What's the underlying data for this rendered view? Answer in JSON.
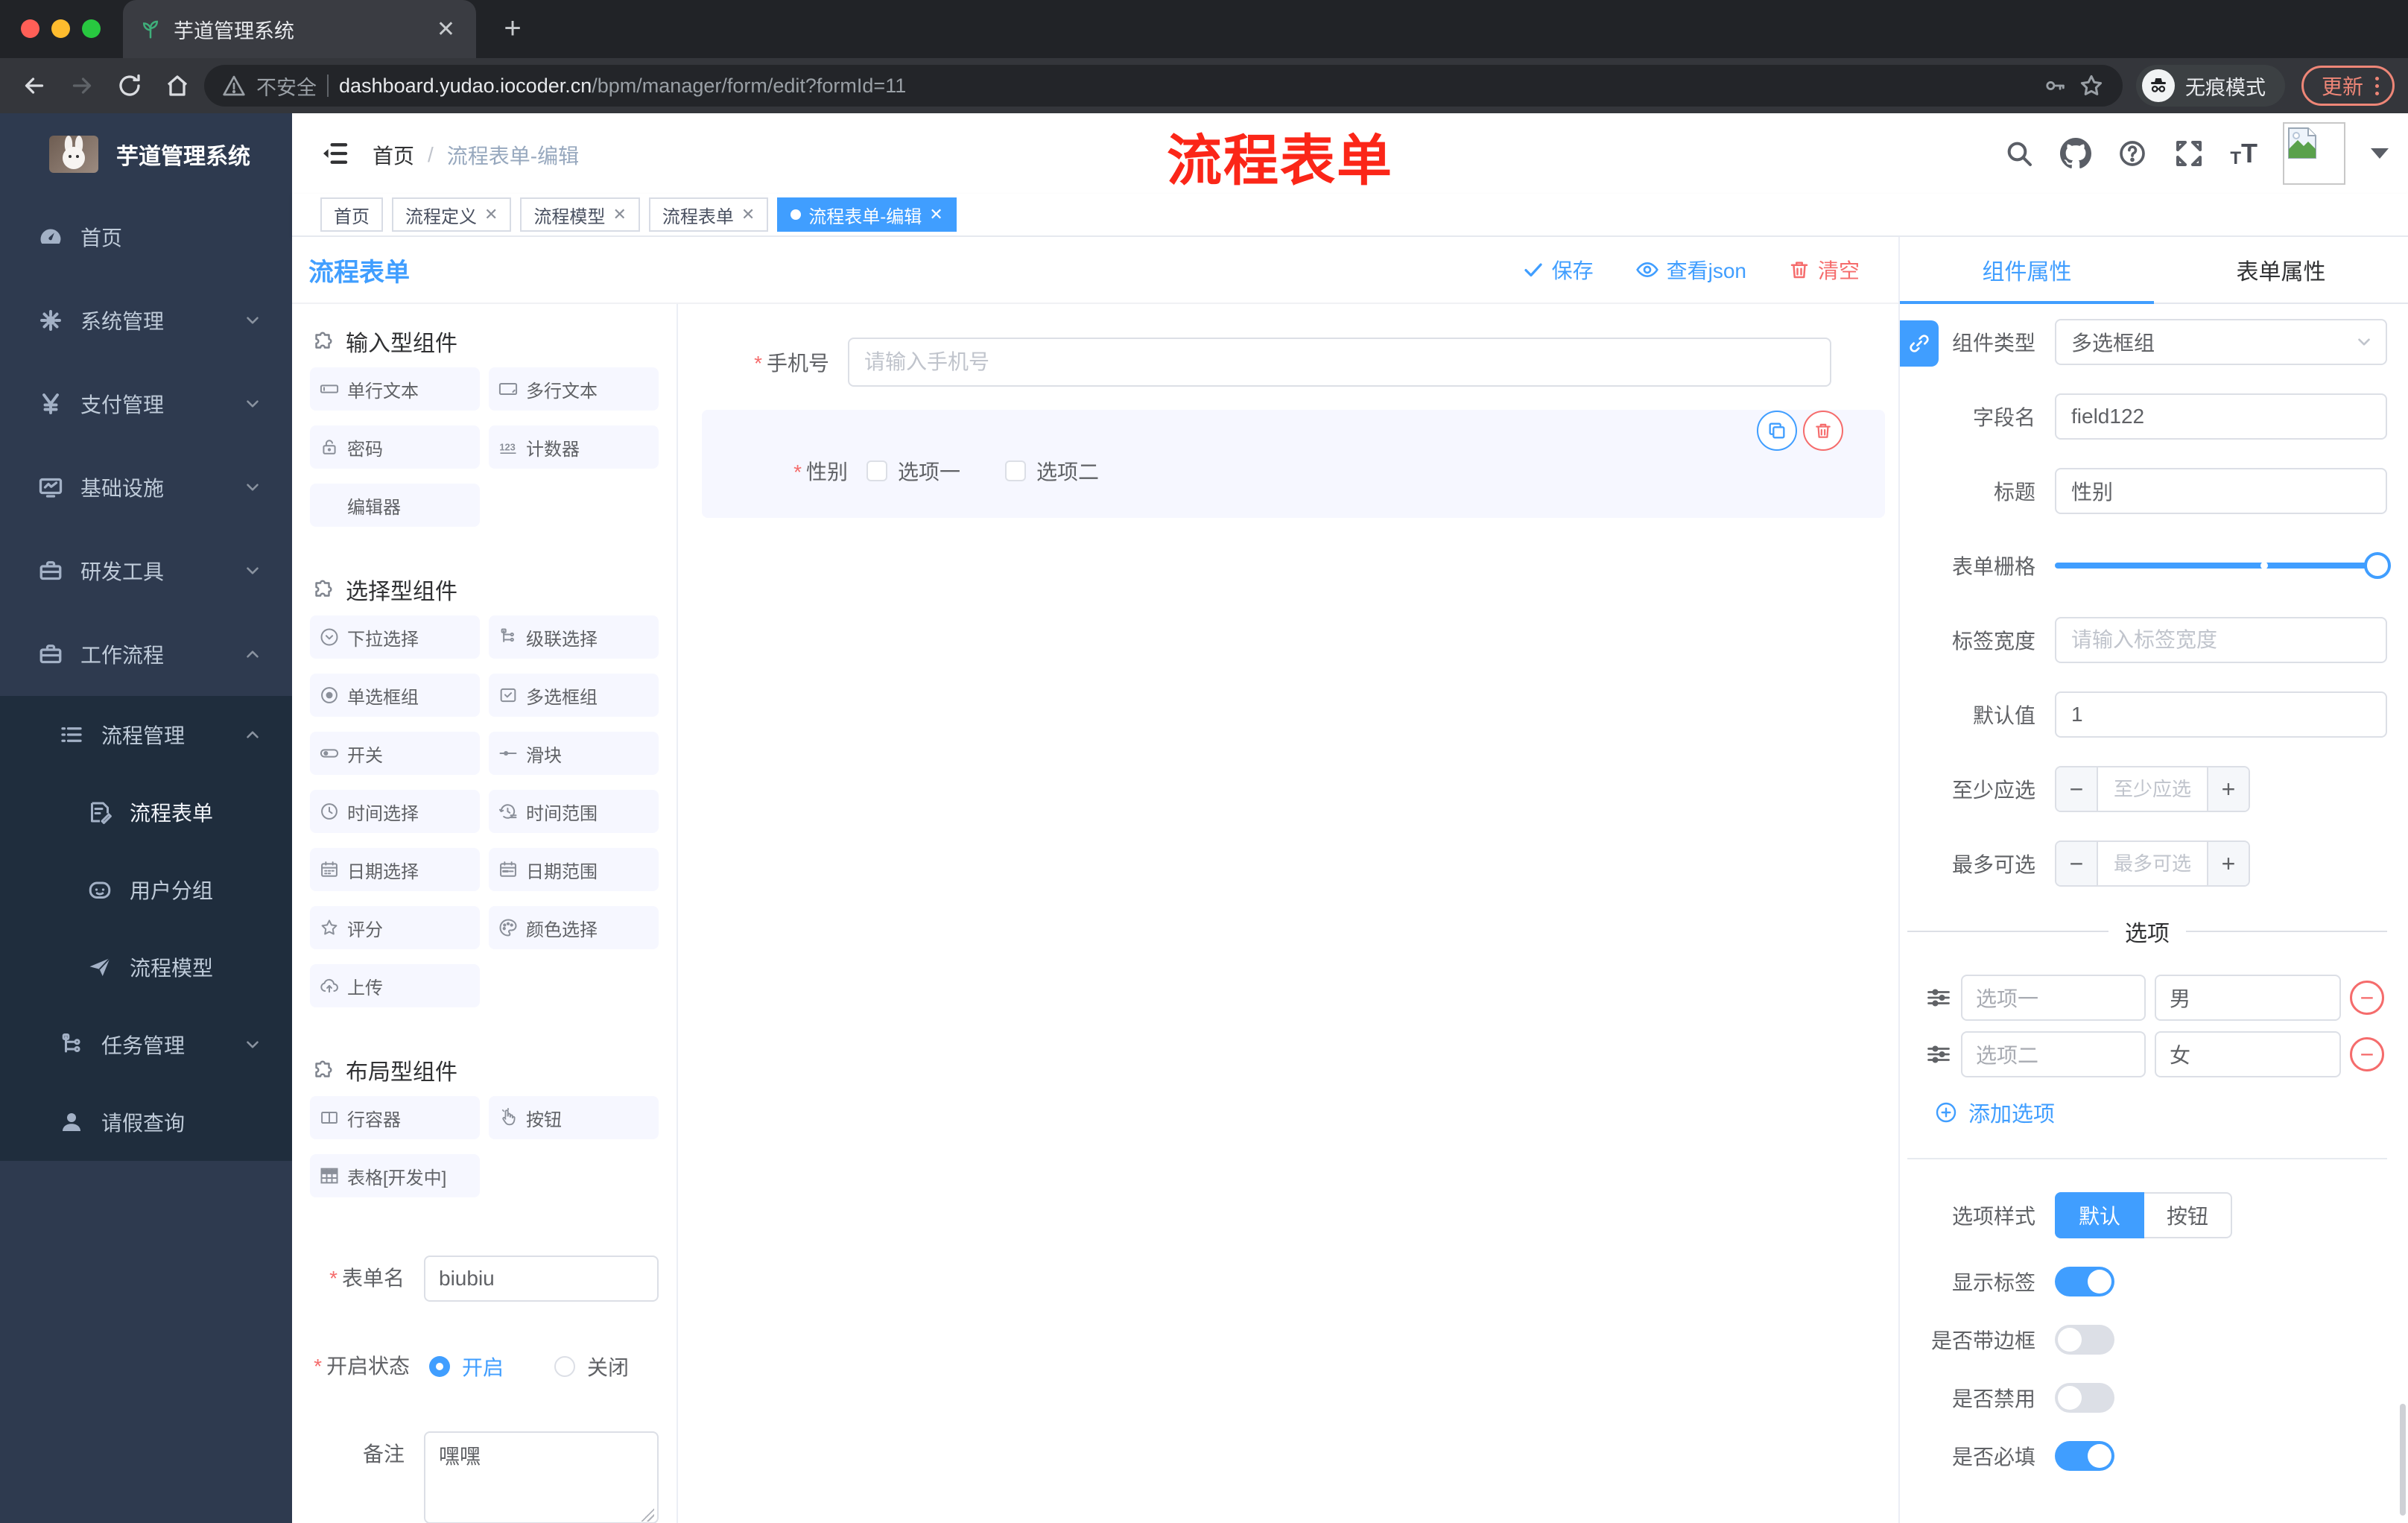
{
  "browser": {
    "tab_title": "芋道管理系统",
    "security_label": "不安全",
    "url_domain": "dashboard.yudao.iocoder.cn",
    "url_path": "/bpm/manager/form/edit?formId=11",
    "incognito_label": "无痕模式",
    "update_label": "更新"
  },
  "sidebar": {
    "title": "芋道管理系统",
    "menu": [
      {
        "label": "首页"
      },
      {
        "label": "系统管理"
      },
      {
        "label": "支付管理"
      },
      {
        "label": "基础设施"
      },
      {
        "label": "研发工具"
      },
      {
        "label": "工作流程"
      }
    ],
    "submenu": [
      {
        "label": "流程管理"
      },
      {
        "label": "流程表单"
      },
      {
        "label": "用户分组"
      },
      {
        "label": "流程模型"
      },
      {
        "label": "任务管理"
      },
      {
        "label": "请假查询"
      }
    ]
  },
  "header": {
    "breadcrumb_home": "首页",
    "breadcrumb_sep": "/",
    "breadcrumb_current": "流程表单-编辑",
    "watermark": "流程表单"
  },
  "tags": [
    {
      "label": "首页"
    },
    {
      "label": "流程定义"
    },
    {
      "label": "流程模型"
    },
    {
      "label": "流程表单"
    },
    {
      "label": "流程表单-编辑"
    }
  ],
  "toolbar": {
    "title": "流程表单",
    "save": "保存",
    "view_json": "查看json",
    "clear": "清空"
  },
  "components": {
    "groups": [
      {
        "title": "输入型组件",
        "items": [
          {
            "label": "单行文本"
          },
          {
            "label": "多行文本"
          },
          {
            "label": "密码"
          },
          {
            "label": "计数器"
          },
          {
            "label": "编辑器"
          }
        ]
      },
      {
        "title": "选择型组件",
        "items": [
          {
            "label": "下拉选择"
          },
          {
            "label": "级联选择"
          },
          {
            "label": "单选框组"
          },
          {
            "label": "多选框组"
          },
          {
            "label": "开关"
          },
          {
            "label": "滑块"
          },
          {
            "label": "时间选择"
          },
          {
            "label": "时间范围"
          },
          {
            "label": "日期选择"
          },
          {
            "label": "日期范围"
          },
          {
            "label": "评分"
          },
          {
            "label": "颜色选择"
          },
          {
            "label": "上传"
          }
        ]
      },
      {
        "title": "布局型组件",
        "items": [
          {
            "label": "行容器"
          },
          {
            "label": "按钮"
          },
          {
            "label": "表格[开发中]"
          }
        ]
      }
    ]
  },
  "form_meta": {
    "name_label": "表单名",
    "name_value": "biubiu",
    "status_label": "开启状态",
    "status_on": "开启",
    "status_off": "关闭",
    "remark_label": "备注",
    "remark_value": "嘿嘿"
  },
  "canvas": {
    "phone_label": "手机号",
    "phone_placeholder": "请输入手机号",
    "gender_label": "性别",
    "gender_options": [
      {
        "label": "选项一"
      },
      {
        "label": "选项二"
      }
    ]
  },
  "props": {
    "tab_component": "组件属性",
    "tab_form": "表单属性",
    "type_label": "组件类型",
    "type_value": "多选框组",
    "field_label": "字段名",
    "field_value": "field122",
    "title_label": "标题",
    "title_value": "性别",
    "grid_label": "表单栅格",
    "width_label": "标签宽度",
    "width_placeholder": "请输入标签宽度",
    "default_label": "默认值",
    "default_value": "1",
    "min_label": "至少应选",
    "min_placeholder": "至少应选",
    "max_label": "最多可选",
    "max_placeholder": "最多可选",
    "options_title": "选项",
    "options": [
      {
        "label": "选项一",
        "value": "男"
      },
      {
        "label": "选项二",
        "value": "女"
      }
    ],
    "add_option": "添加选项",
    "style_label": "选项样式",
    "style_default": "默认",
    "style_button": "按钮",
    "switches": [
      {
        "label": "显示标签",
        "on": true
      },
      {
        "label": "是否带边框",
        "on": false
      },
      {
        "label": "是否禁用",
        "on": false
      },
      {
        "label": "是否必填",
        "on": true
      }
    ]
  },
  "colors": {
    "accent": "#409eff",
    "danger": "#f56c6c",
    "watermark": "#fb2618",
    "sidebar": "#2e3a4f"
  }
}
